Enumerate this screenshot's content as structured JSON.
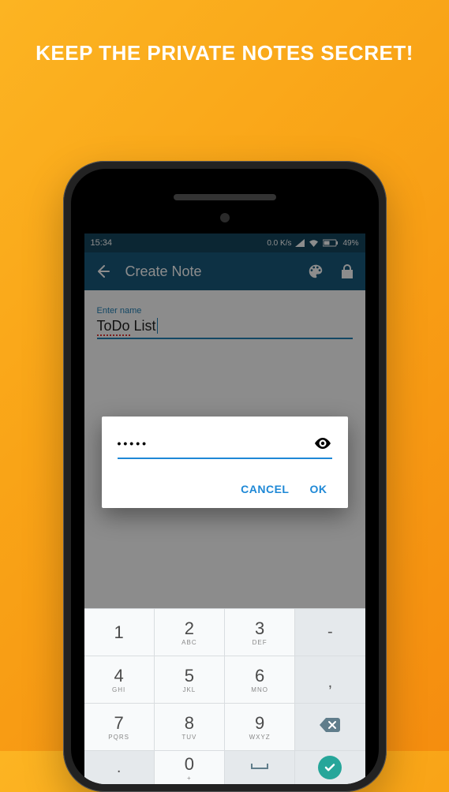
{
  "headline": "KEEP THE PRIVATE NOTES SECRET!",
  "statusbar": {
    "time": "15:34",
    "speed": "0.0 K/s",
    "battery": "49%"
  },
  "appbar": {
    "title": "Create Note"
  },
  "note": {
    "name_label": "Enter name",
    "name_value_part1": "ToDo",
    "name_value_part2": " List"
  },
  "dialog": {
    "pin_masked": "•••••",
    "cancel": "CANCEL",
    "ok": "OK"
  },
  "keypad": {
    "k1": "1",
    "k1s": "",
    "k2": "2",
    "k2s": "ABC",
    "k3": "3",
    "k3s": "DEF",
    "kdash": "-",
    "k4": "4",
    "k4s": "GHI",
    "k5": "5",
    "k5s": "JKL",
    "k6": "6",
    "k6s": "MNO",
    "kcomma": ",",
    "k7": "7",
    "k7s": "PQRS",
    "k8": "8",
    "k8s": "TUV",
    "k9": "9",
    "k9s": "WXYZ",
    "kdot": ".",
    "k0": "0",
    "kplus": "+"
  }
}
